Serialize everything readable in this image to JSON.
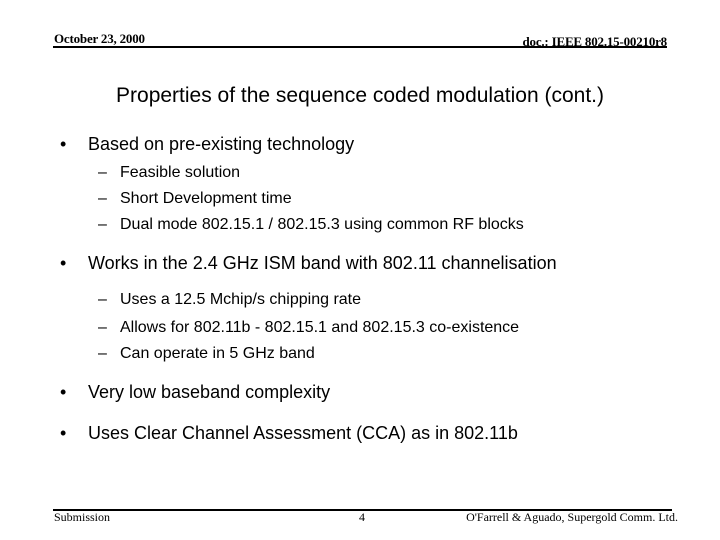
{
  "header": {
    "date": "October 23, 2000",
    "doc_id": "doc.: IEEE 802.15-00210r8"
  },
  "title": "Properties of the sequence coded modulation (cont.)",
  "bullet_glyph": "•",
  "dash_glyph": "–",
  "bullets": [
    {
      "text": "Based on pre-existing technology",
      "subs": [
        "Feasible solution",
        "Short Development time",
        "Dual mode 802.15.1 / 802.15.3 using common RF blocks"
      ]
    },
    {
      "text": "Works in the 2.4 GHz ISM band with 802.11 channelisation",
      "subs": [
        "Uses a 12.5 Mchip/s chipping rate",
        "Allows for 802.11b - 802.15.1 and 802.15.3 co-existence",
        "Can operate in 5 GHz band"
      ]
    },
    {
      "text": "Very low baseband complexity",
      "subs": []
    },
    {
      "text": "Uses Clear Channel Assessment (CCA) as in 802.11b",
      "subs": []
    }
  ],
  "footer": {
    "left": "Submission",
    "page_number": "4",
    "right": "O'Farrell & Aguado, Supergold Comm. Ltd."
  }
}
